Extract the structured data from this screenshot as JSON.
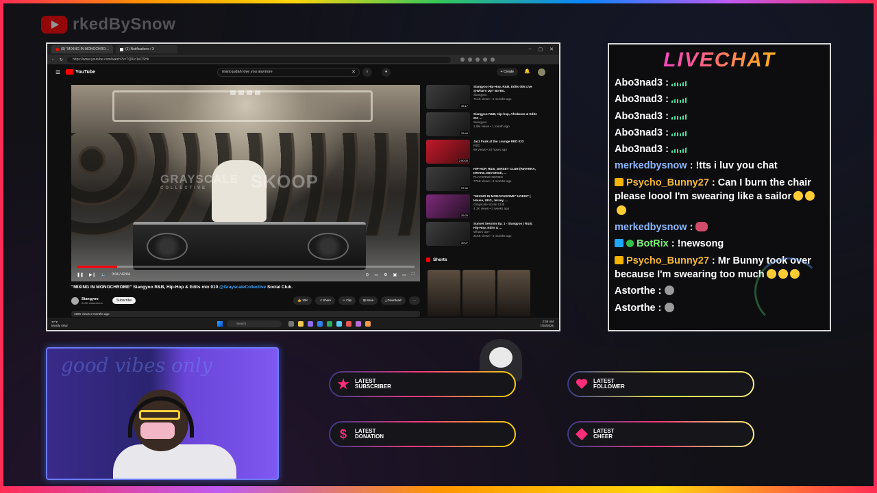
{
  "brand": {
    "name": "rkedBySnow",
    "icon": "youtube-logo-icon"
  },
  "browser": {
    "tabs": [
      {
        "label": "(9) \"MIXING IN MONOCHRO…",
        "active": true
      },
      {
        "label": "(1) Notifications / X",
        "active": false
      }
    ],
    "url": "https://www.youtube.com/watch?v=TQIUc1eCSHk",
    "window_controls": {
      "minimize": "–",
      "maximize": "▢",
      "close": "✕"
    }
  },
  "youtube": {
    "logo_text": "YouTube",
    "search_value": "mario judah love you anymore",
    "create_label": "+ Create",
    "player": {
      "watermark_left": "GRAYSCALE",
      "watermark_left_sub": "COLLECTIVE",
      "watermark_right": "SKOOP",
      "time": "0:04 / 42:04",
      "progress_fraction": 0.12
    },
    "video_title": "\"MIXING IN MONOCHROME\" Siangyoo R&B, Hip-Hop & Edits mix 010",
    "video_tag": "@GrayscaleCollective",
    "video_title_suffix": "Social Club.",
    "channel": {
      "name": "Siangyoo",
      "subs": "244K subscribers"
    },
    "subscribe_label": "Subscribe",
    "actions": {
      "like": "👍 10K",
      "share": "↗ Share",
      "clip": "✂ Clip",
      "save": "⊞ Save",
      "download": "⤓ Download",
      "more": "···"
    },
    "views": "468K views  2 months ago",
    "recommendations": [
      {
        "title": "Siangyoo Hip-Hop, R&B, Edits 006 Live @What's Up? Bo-Bo.",
        "channel": "Siangyoo",
        "meta": "714K views • 5 months ago",
        "duration": "35:17",
        "style": ""
      },
      {
        "title": "Siangyoo R&B, Hip-hop, Afrobeats & Edits 011 ...",
        "channel": "Siangyoo",
        "meta": "1.5M views • 1 month ago",
        "duration": "33:44",
        "style": ""
      },
      {
        "title": "Jazz Funk at the Lounge  RED 033",
        "channel": "RED",
        "meta": "69 views • 20 hours ago",
        "duration": "2:00:00",
        "style": "red"
      },
      {
        "title": "HIP-HOP, R&B, JERSEY CLUB (RIHANNA, DRAKE, BEYONCÉ, ...",
        "channel": "PLAYGRND SERIES",
        "meta": "776K views • 3 months ago",
        "duration": "57:32",
        "style": ""
      },
      {
        "title": "\"MIXING IN MONOCHROME\" HOEIST | House, UKG, Jersey, ...",
        "channel": "Grayscale Social Club",
        "meta": "4.1K views • 3 weeks ago",
        "duration": "29:20",
        "style": "pink"
      },
      {
        "title": "Sunset Session Ep. 1 - Siangyoo | R&B, Hip-Hop, Edits & ...",
        "channel": "What's Up?",
        "meta": "216K views • 4 months ago",
        "duration": "30:07",
        "style": ""
      }
    ],
    "shorts_label": "Shorts"
  },
  "taskbar": {
    "weather": "77°F",
    "weather_sub": "Mostly clear",
    "search": "Search",
    "time": "2:58 AM",
    "date": "7/26/2025"
  },
  "livechat": {
    "title": "LIVECHAT",
    "messages": [
      {
        "user": "Abo3nad3",
        "color": "",
        "badges": [],
        "text": "",
        "emote": "bars"
      },
      {
        "user": "Abo3nad3",
        "color": "",
        "badges": [],
        "text": "",
        "emote": "bars"
      },
      {
        "user": "Abo3nad3",
        "color": "",
        "badges": [],
        "text": "",
        "emote": "bars"
      },
      {
        "user": "Abo3nad3",
        "color": "",
        "badges": [],
        "text": "",
        "emote": "bars"
      },
      {
        "user": "Abo3nad3",
        "color": "",
        "badges": [],
        "text": "",
        "emote": "bars"
      },
      {
        "user": "merkedbysnow",
        "color": "purple",
        "badges": [
          "mic"
        ],
        "text": "!tts i luv you chat",
        "emote": ""
      },
      {
        "user": "Psycho_Bunny27",
        "color": "gold",
        "badges": [
          "crown"
        ],
        "text": "Can I burn the chair please loool I'm swearing like a sailor",
        "emote": "laugh3"
      },
      {
        "user": "merkedbysnow",
        "color": "purple",
        "badges": [
          "mic"
        ],
        "text": "",
        "emote": "face"
      },
      {
        "user": "BotRix",
        "color": "green",
        "badges": [
          "bot",
          "check"
        ],
        "text": "!newsong",
        "emote": ""
      },
      {
        "user": "Psycho_Bunny27",
        "color": "gold",
        "badges": [
          "crown"
        ],
        "text": "Mr Bunny took over because I'm swearing too much",
        "emote": "laugh3"
      },
      {
        "user": "Astorthe",
        "color": "",
        "badges": [],
        "text": "",
        "emote": "grey"
      },
      {
        "user": "Astorthe",
        "color": "",
        "badges": [],
        "text": "",
        "emote": "grey"
      }
    ]
  },
  "webcam": {
    "neon_text": "good vibes only"
  },
  "alerts": {
    "subscriber": {
      "label": "LATEST SUBSCRIBER",
      "icon": "star-icon"
    },
    "follower": {
      "label": "LATEST FOLLOWER",
      "icon": "heart-icon"
    },
    "donation": {
      "label": "LATEST DONATION",
      "icon": "dollar-icon"
    },
    "cheer": {
      "label": "LATEST CHEER",
      "icon": "gem-icon"
    }
  }
}
